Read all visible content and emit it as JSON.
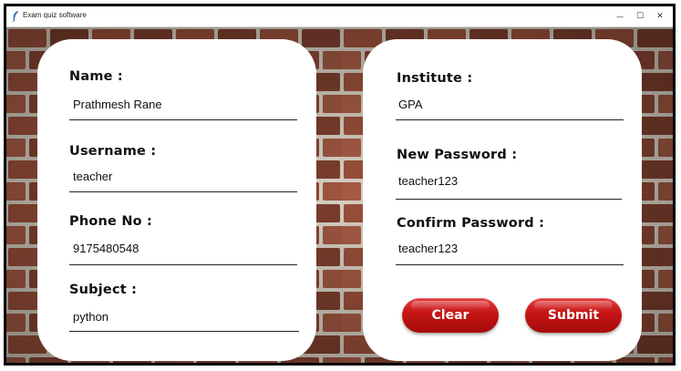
{
  "window": {
    "title": "Exam quiz software",
    "minimize_glyph": "—",
    "maximize_glyph": "☐",
    "close_glyph": "✕"
  },
  "left_panel": {
    "name": {
      "label": "Name :",
      "value": "Prathmesh Rane"
    },
    "username": {
      "label": "Username :",
      "value": "teacher"
    },
    "phone": {
      "label": "Phone No :",
      "value": "9175480548"
    },
    "subject": {
      "label": "Subject :",
      "value": "python"
    }
  },
  "right_panel": {
    "institute": {
      "label": "Institute :",
      "value": "GPA"
    },
    "new_password": {
      "label": "New Password :",
      "value": "teacher123"
    },
    "confirm_password": {
      "label": "Confirm Password :",
      "value": "teacher123"
    }
  },
  "buttons": {
    "clear": "Clear",
    "submit": "Submit"
  },
  "colors": {
    "button_red": "#c51515",
    "card_bg": "#ffffff",
    "brick_wall": "#8a4a36"
  }
}
